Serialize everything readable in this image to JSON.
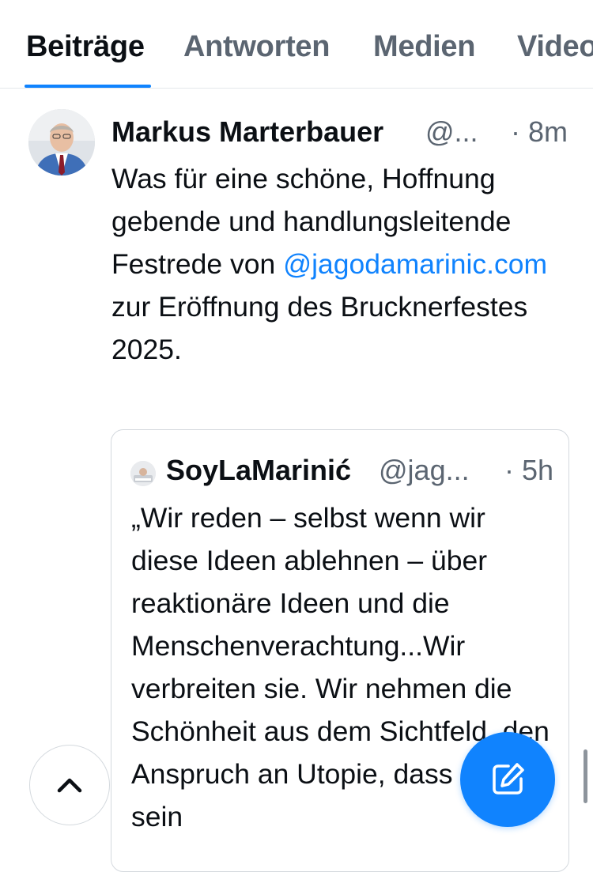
{
  "tabs": [
    {
      "label": "Beiträge",
      "active": true
    },
    {
      "label": "Antworten",
      "active": false
    },
    {
      "label": "Medien",
      "active": false
    },
    {
      "label": "Videos",
      "active": false
    }
  ],
  "post": {
    "author_name": "Markus Marterbauer",
    "author_handle": "@...",
    "time": "· 8m",
    "text_before": "Was für eine schöne, Hoffnung gebende und handlungsleitende Festrede von ",
    "mention": "@jagodamarinic.com",
    "text_after": " zur Eröffnung des Brucknerfestes 2025.",
    "quote": {
      "author_name": "SoyLaMarinić",
      "author_handle": "@jag...",
      "time": "· 5h",
      "text": "„Wir reden – selbst wenn wir diese Ideen ablehnen – über reaktionäre Ideen und die Menschenverachtung...Wir verbreiten sie. Wir nehmen die Schönheit aus dem Sichtfeld, den Anspruch an Utopie, dass mehr sein"
    }
  },
  "icons": {
    "scroll_top": "chevron-up-icon",
    "compose": "compose-icon"
  },
  "colors": {
    "accent": "#1083fe",
    "text": "#0b0f14",
    "muted": "#5b6571",
    "border": "#d4d9de"
  }
}
